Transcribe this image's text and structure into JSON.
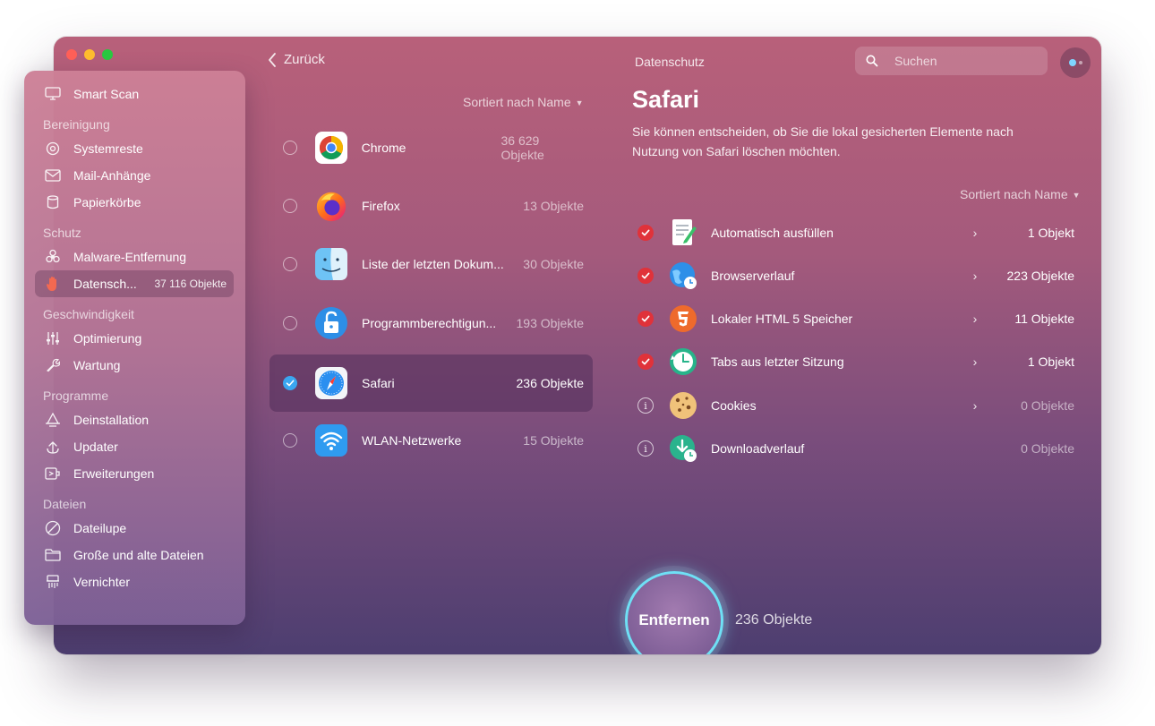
{
  "window": {
    "title": "Datenschutz"
  },
  "toolbar": {
    "back_label": "Zurück",
    "search_placeholder": "Suchen"
  },
  "sidebar": {
    "smart_scan": "Smart Scan",
    "sections": {
      "bereinigung": "Bereinigung",
      "schutz": "Schutz",
      "geschwindigkeit": "Geschwindigkeit",
      "programme": "Programme",
      "dateien": "Dateien"
    },
    "items": {
      "systemreste": "Systemreste",
      "mail": "Mail-Anhänge",
      "papierkoerbe": "Papierkörbe",
      "malware": "Malware-Entfernung",
      "datenschutz": "Datensch...",
      "datenschutz_count": "37 116 Objekte",
      "optimierung": "Optimierung",
      "wartung": "Wartung",
      "deinstallation": "Deinstallation",
      "updater": "Updater",
      "erweiterungen": "Erweiterungen",
      "dateilupe": "Dateilupe",
      "grosse_dateien": "Große und alte Dateien",
      "vernichter": "Vernichter"
    }
  },
  "apps": {
    "sort_label": "Sortiert nach Name",
    "list": [
      {
        "name": "Chrome",
        "count": "36 629 Objekte",
        "selected": false
      },
      {
        "name": "Firefox",
        "count": "13 Objekte",
        "selected": false
      },
      {
        "name": "Liste der letzten Dokum...",
        "count": "30 Objekte",
        "selected": false
      },
      {
        "name": "Programmberechtigun...",
        "count": "193 Objekte",
        "selected": false
      },
      {
        "name": "Safari",
        "count": "236 Objekte",
        "selected": true
      },
      {
        "name": "WLAN-Netzwerke",
        "count": "15 Objekte",
        "selected": false
      }
    ]
  },
  "detail": {
    "title": "Safari",
    "description": "Sie können entscheiden, ob Sie die lokal gesicherten Elemente nach Nutzung von Safari löschen möchten.",
    "sort_label": "Sortiert nach Name",
    "categories": [
      {
        "name": "Automatisch ausfüllen",
        "count": "1 Objekt",
        "checked": true
      },
      {
        "name": "Browserverlauf",
        "count": "223 Objekte",
        "checked": true
      },
      {
        "name": "Lokaler HTML 5 Speicher",
        "count": "11 Objekte",
        "checked": true
      },
      {
        "name": "Tabs aus letzter Sitzung",
        "count": "1 Objekt",
        "checked": true
      },
      {
        "name": "Cookies",
        "count": "0 Objekte",
        "checked": false
      },
      {
        "name": "Downloadverlauf",
        "count": "0 Objekte",
        "checked": false
      }
    ]
  },
  "action": {
    "button_label": "Entfernen",
    "total": "236 Objekte"
  },
  "colors": {
    "accent_cyan": "#6fe0f5",
    "check_red": "#e0323a",
    "select_blue": "#3aa6f0"
  }
}
